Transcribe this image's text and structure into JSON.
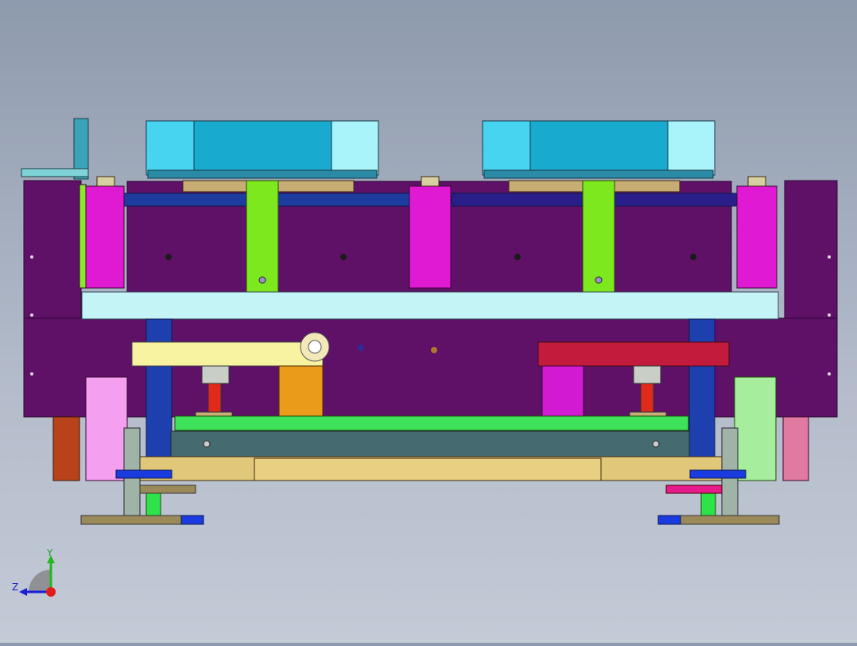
{
  "viewport": {
    "background_top": "#8e9aad",
    "background_bottom": "#c4cad6"
  },
  "triad": {
    "y_label": "Y",
    "z_label": "Z",
    "y_color": "#1fb81f",
    "z_color": "#1a1fd6",
    "origin_color": "#e01b1b"
  },
  "colors": {
    "frame_purple": "#5f1168",
    "cylinder_magenta": "#e01ad2",
    "rail_blue": "#1e3b9e",
    "lime": "#7ee81e",
    "cyan_block": "#18aacf",
    "pale_cyan": "#c5f4f6",
    "yellow_plate": "#f7f3a0",
    "red_plate": "#c21b3c",
    "orange_block": "#ea9b1a",
    "base_tan": "#e1c77a",
    "teal_bar": "#456b70",
    "post_gray": "#9fb3a6"
  }
}
